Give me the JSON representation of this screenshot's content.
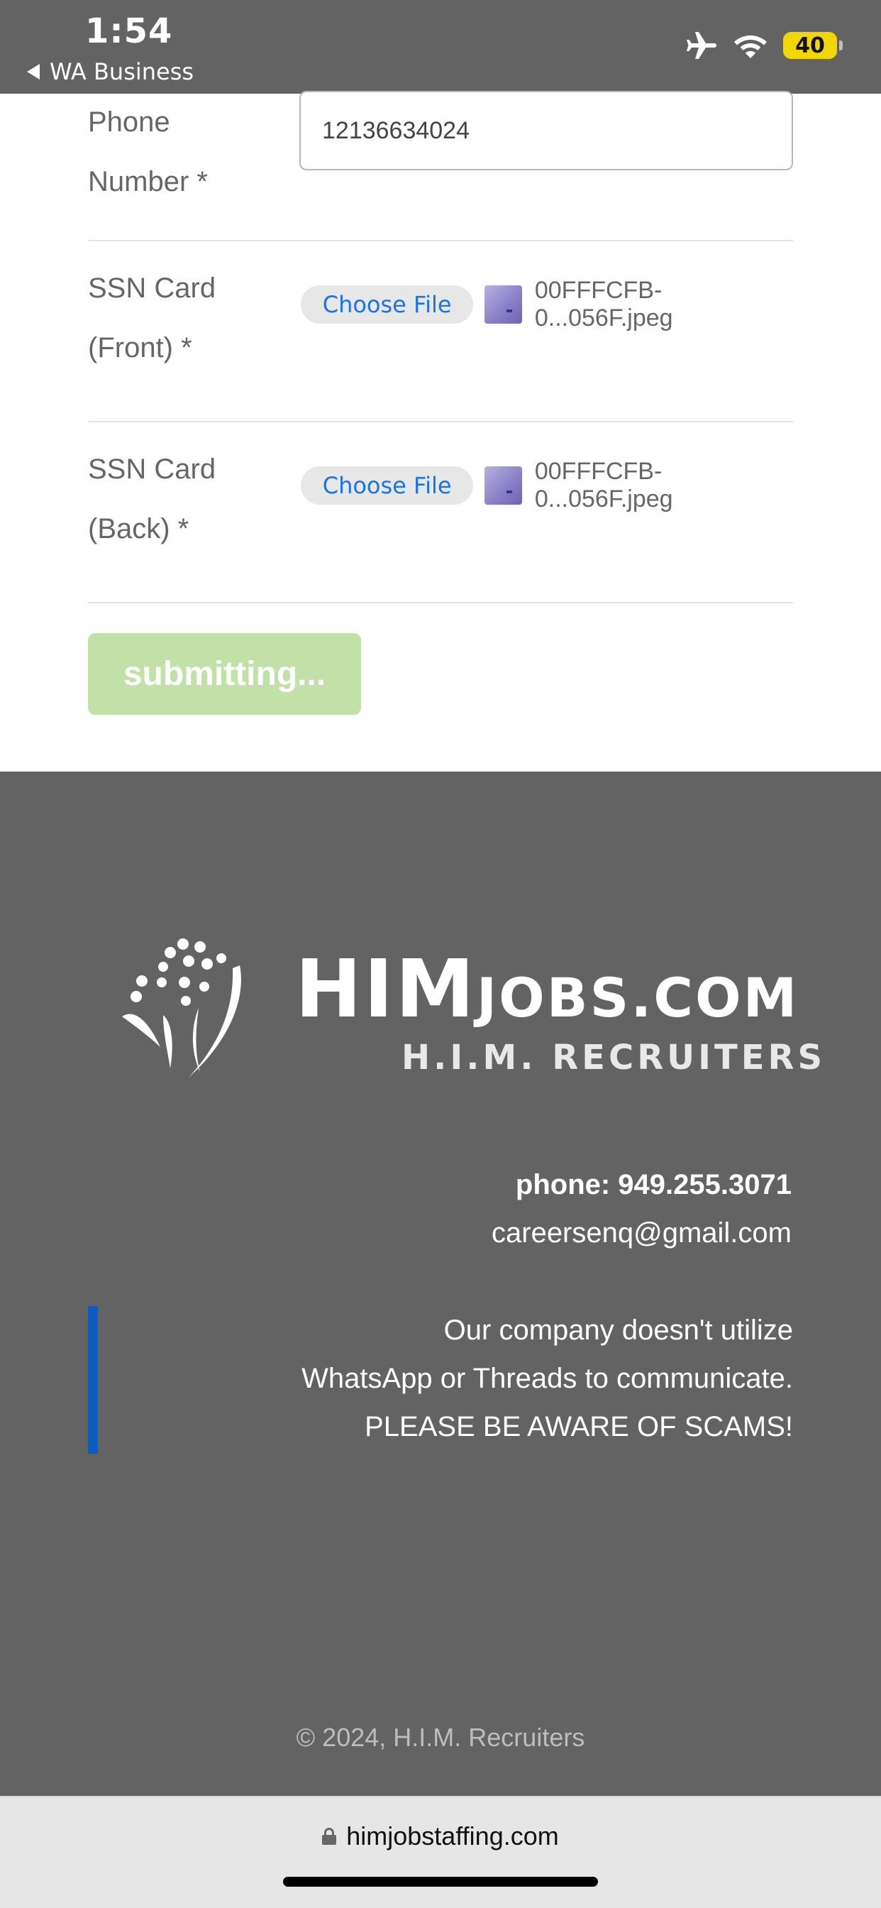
{
  "status_bar": {
    "time": "1:54",
    "back_app": "WA Business",
    "battery_level": "40",
    "icons": [
      "airplane-icon",
      "wifi-icon",
      "battery-icon"
    ]
  },
  "form": {
    "phone": {
      "label_line1": "Phone",
      "label_line2": "Number *",
      "value": "12136634024"
    },
    "ssn_front": {
      "label_line1": "SSN Card",
      "label_line2": "(Front) *",
      "button_label": "Choose File",
      "file_name": "00FFFCFB-0...056F.jpeg"
    },
    "ssn_back": {
      "label_line1": "SSN Card",
      "label_line2": "(Back) *",
      "button_label": "Choose File",
      "file_name": "00FFFCFB-0...056F.jpeg"
    },
    "submit_label": "submitting..."
  },
  "footer": {
    "logo_title_big": "HIM",
    "logo_title_small": "JOBS.COM",
    "logo_subtitle": "H.I.M. RECRUITERS",
    "contact_phone": "phone: 949.255.3071",
    "contact_email": "careersenq@gmail.com",
    "notice_line1": "Our company doesn't utilize",
    "notice_line2": "WhatsApp or Threads to communicate.",
    "notice_line3": "PLEASE BE AWARE OF SCAMS!",
    "copyright": "© 2024, H.I.M. Recruiters"
  },
  "browser": {
    "url": "himjobstaffing.com"
  },
  "colors": {
    "status_bar_bg": "#636363",
    "footer_bg": "#636363",
    "submit_bg": "#c2e1a8",
    "link_blue": "#1a73e8",
    "notice_bar": "#0b5cbf",
    "battery": "#f2d600"
  }
}
